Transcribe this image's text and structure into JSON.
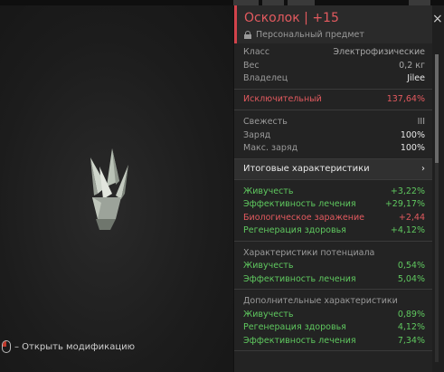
{
  "item": {
    "title": "Осколок | +15",
    "subtitle": "Персональный предмет",
    "info": [
      {
        "key": "Класс",
        "value": "Электрофизические"
      },
      {
        "key": "Вес",
        "value": "0,2 кг"
      },
      {
        "key": "Владелец",
        "value": "Jilee"
      }
    ],
    "rarity": {
      "label": "Исключительный",
      "value": "137,64%"
    },
    "stats": [
      {
        "key": "Свежесть",
        "value": "III"
      },
      {
        "key": "Заряд",
        "value": "100%"
      },
      {
        "key": "Макс. заряд",
        "value": "100%"
      }
    ],
    "summary_label": "Итоговые характеристики",
    "summary_arrow": "›",
    "summary": [
      {
        "key": "Живучесть",
        "value": "+3,22%",
        "color": "green"
      },
      {
        "key": "Эффективность лечения",
        "value": "+29,17%",
        "color": "green"
      },
      {
        "key": "Биологическое заражение",
        "value": "+2,44",
        "color": "red"
      },
      {
        "key": "Регенерация здоровья",
        "value": "+4,12%",
        "color": "green"
      }
    ],
    "potential": {
      "title": "Характеристики потенциала",
      "rows": [
        {
          "key": "Живучесть",
          "value": "0,54%"
        },
        {
          "key": "Эффективность лечения",
          "value": "5,04%"
        }
      ]
    },
    "additional": {
      "title": "Дополнительные характеристики",
      "rows": [
        {
          "key": "Живучесть",
          "value": "0,89%"
        },
        {
          "key": "Регенерация здоровья",
          "value": "4,12%"
        },
        {
          "key": "Эффективность лечения",
          "value": "7,34%"
        }
      ]
    }
  },
  "hint": {
    "text": "– Открыть модификацию",
    "icon": "mouse-left-click-icon"
  },
  "close": "×",
  "colors": {
    "accent": "#d2434b",
    "red": "#e35a5f",
    "green": "#5fc85f"
  }
}
